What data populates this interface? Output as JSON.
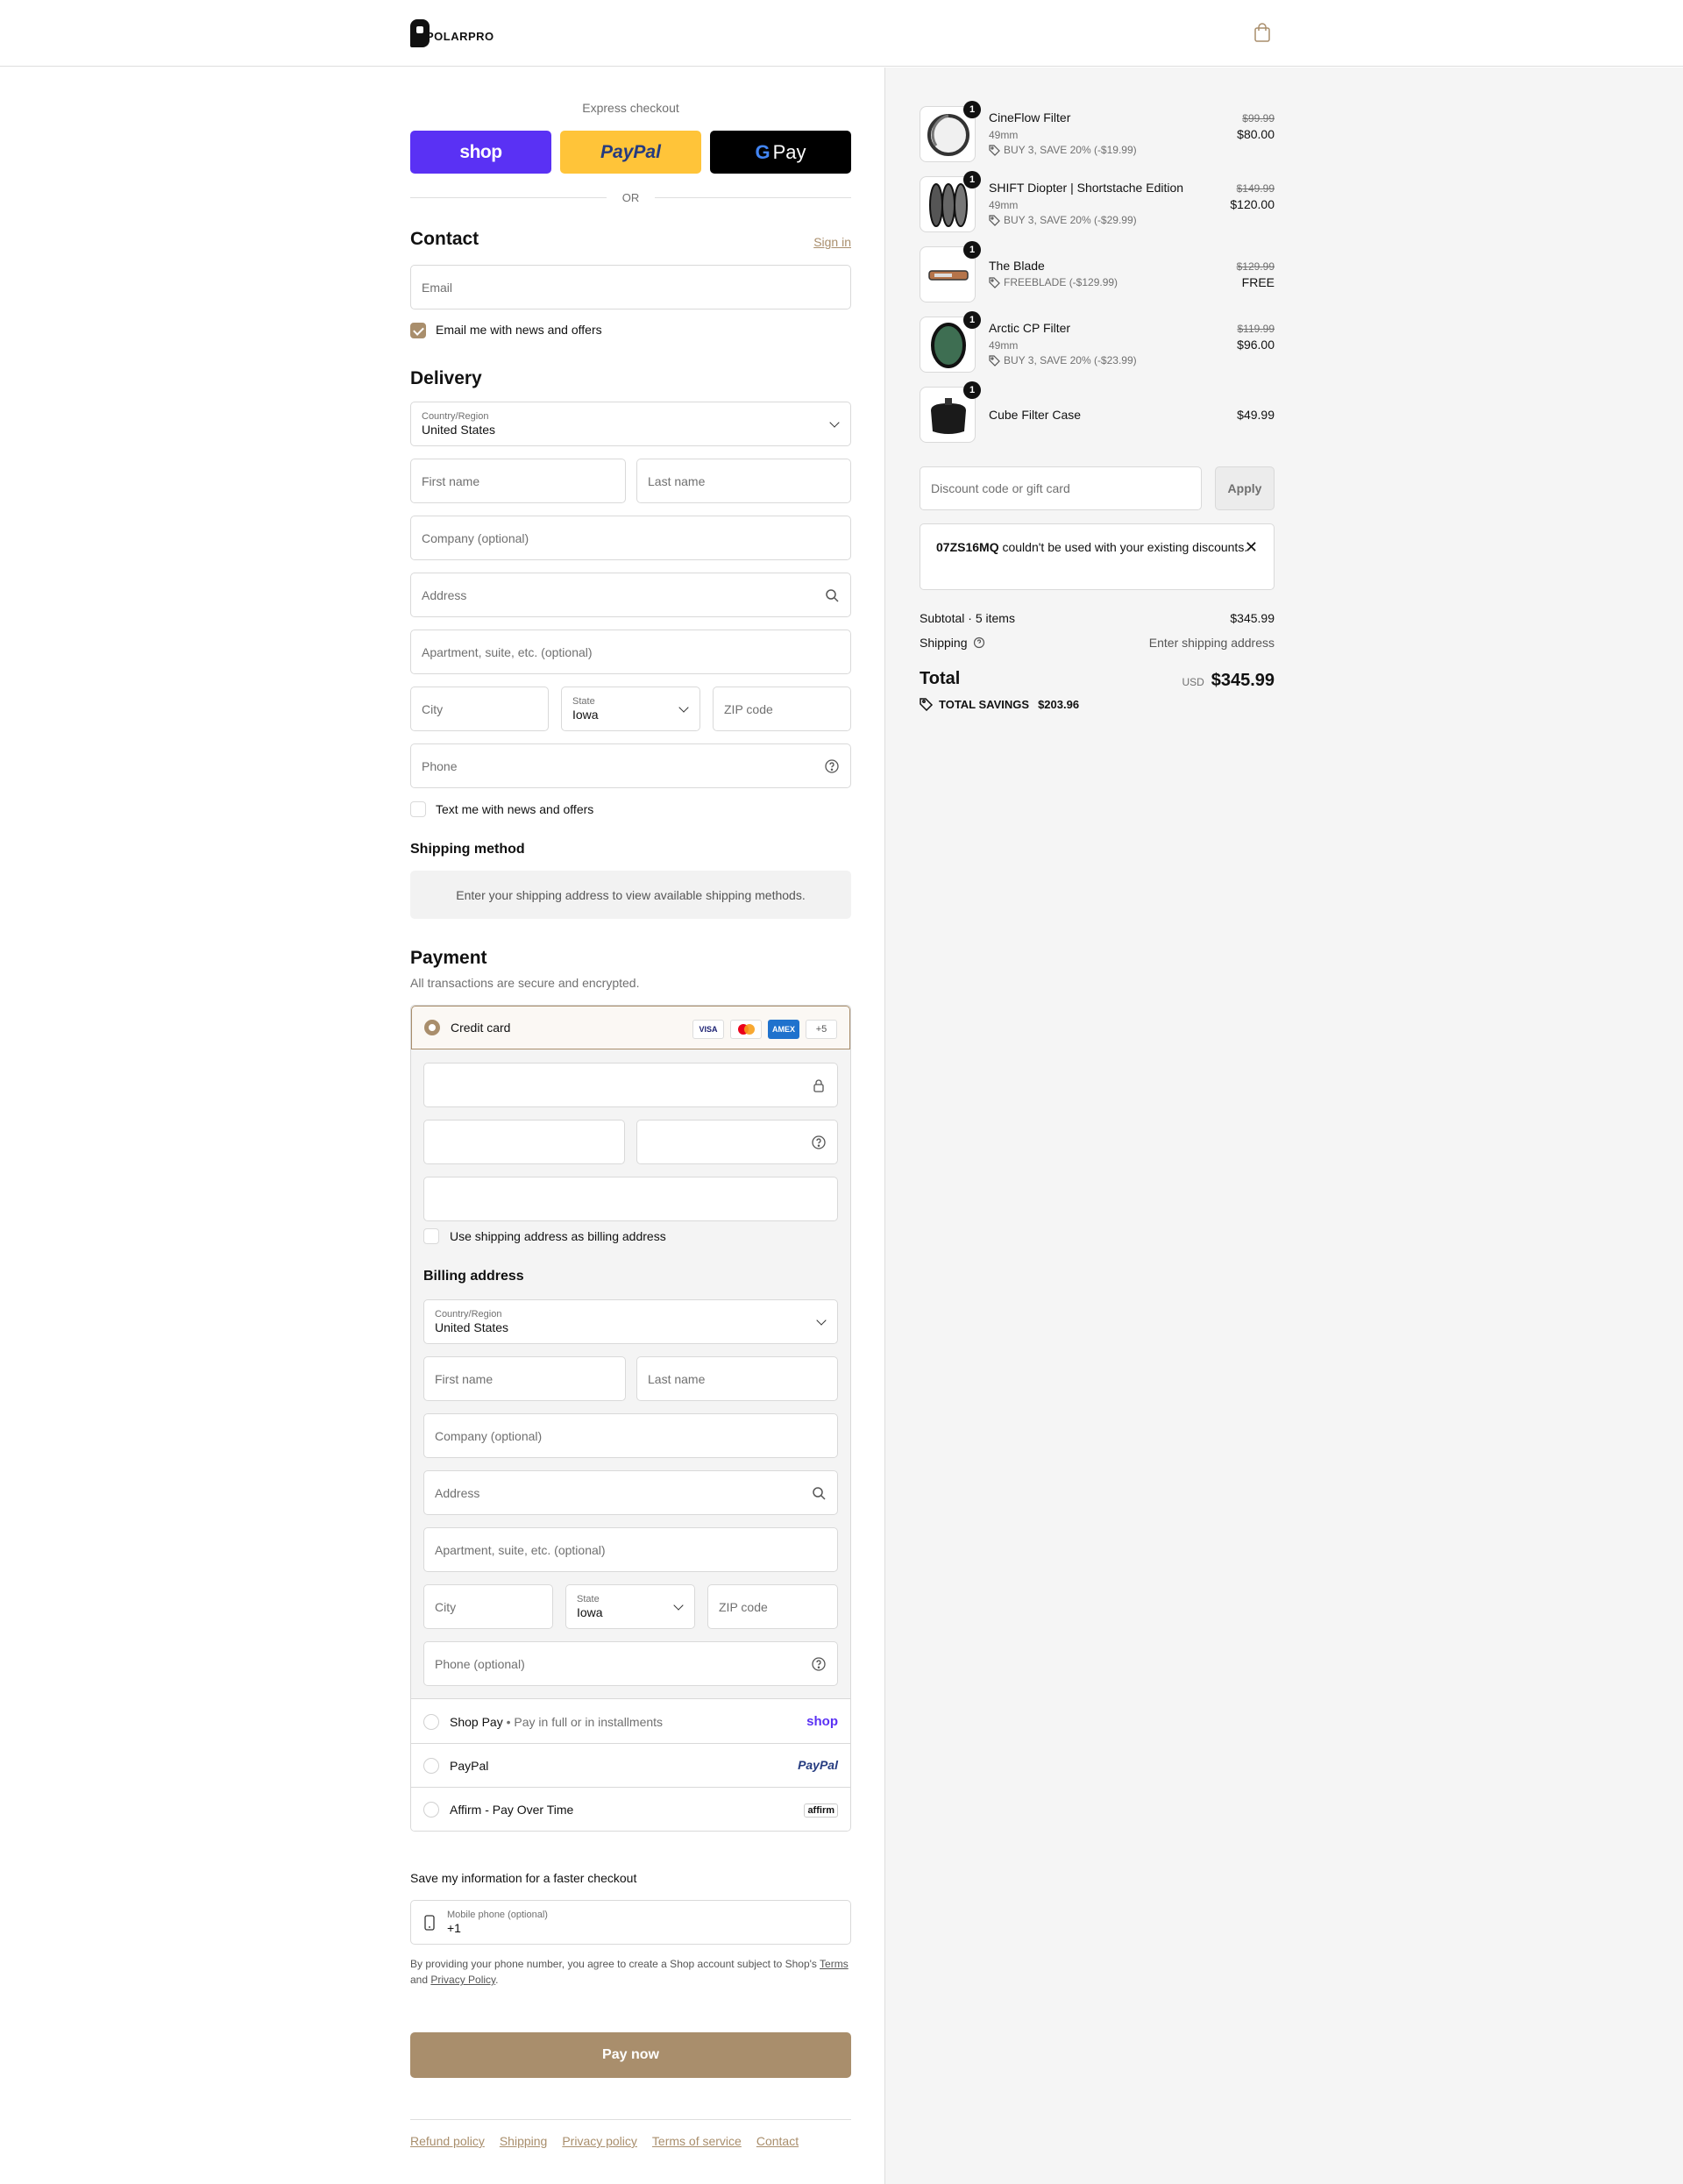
{
  "brand": {
    "name": "POLARPRO",
    "accent": "#a98e6c"
  },
  "header": {
    "cart_icon": "shopping-bag-icon"
  },
  "express": {
    "label": "Express checkout",
    "shop_label": "shop",
    "paypal_label": "PayPal",
    "gpay_label": "Pay",
    "or_label": "OR"
  },
  "contact": {
    "title": "Contact",
    "sign_in": "Sign in",
    "email_placeholder": "Email",
    "news_label": "Email me with news and offers"
  },
  "delivery": {
    "title": "Delivery",
    "country_label": "Country/Region",
    "country_value": "United States",
    "first_name": "First name",
    "last_name": "Last name",
    "company": "Company (optional)",
    "address": "Address",
    "apartment": "Apartment, suite, etc. (optional)",
    "city": "City",
    "state_label": "State",
    "state_value": "Iowa",
    "zip": "ZIP code",
    "phone": "Phone",
    "text_label": "Text me with news and offers"
  },
  "shipping": {
    "title": "Shipping method",
    "message": "Enter your shipping address to view available shipping methods."
  },
  "payment": {
    "title": "Payment",
    "subtitle": "All transactions are secure and encrypted.",
    "credit_card": "Credit card",
    "card_visa": "VISA",
    "card_amex": "AMEX",
    "card_more": "+5",
    "use_shipping": "Use shipping address as billing address",
    "billing_title": "Billing address",
    "billing": {
      "country_label": "Country/Region",
      "country_value": "United States",
      "first_name": "First name",
      "last_name": "Last name",
      "company": "Company (optional)",
      "address": "Address",
      "apartment": "Apartment, suite, etc. (optional)",
      "city": "City",
      "state_label": "State",
      "state_value": "Iowa",
      "zip": "ZIP code",
      "phone": "Phone (optional)"
    },
    "methods": [
      {
        "name": "Shop Pay",
        "sub": "Pay in full or in installments",
        "brand": "shop"
      },
      {
        "name": "PayPal",
        "sub": "",
        "brand": "PayPal"
      },
      {
        "name": "Affirm - Pay Over Time",
        "sub": "",
        "brand": "affirm"
      }
    ]
  },
  "save_info": {
    "title": "Save my information for a faster checkout",
    "phone_label": "Mobile phone (optional)",
    "phone_value": "+1",
    "terms_prefix": "By providing your phone number, you agree to create a Shop account subject to Shop's",
    "terms_link": "Terms",
    "terms_and": "and",
    "privacy_link": "Privacy Policy",
    "terms_suffix": "."
  },
  "pay_now": "Pay now",
  "footer_links": [
    "Refund policy",
    "Shipping",
    "Privacy policy",
    "Terms of service",
    "Contact"
  ],
  "cart": {
    "items": [
      {
        "qty": "1",
        "name": "CineFlow Filter",
        "variant": "49mm",
        "discount": "BUY 3, SAVE 20% (-$19.99)",
        "old_price": "$99.99",
        "price": "$80.00"
      },
      {
        "qty": "1",
        "name": "SHIFT Diopter | Shortstache Edition",
        "variant": "49mm",
        "discount": "BUY 3, SAVE 20% (-$29.99)",
        "old_price": "$149.99",
        "price": "$120.00"
      },
      {
        "qty": "1",
        "name": "The Blade",
        "variant": "",
        "discount": "FREEBLADE (-$129.99)",
        "old_price": "$129.99",
        "price": "FREE"
      },
      {
        "qty": "1",
        "name": "Arctic CP Filter",
        "variant": "49mm",
        "discount": "BUY 3, SAVE 20% (-$23.99)",
        "old_price": "$119.99",
        "price": "$96.00"
      },
      {
        "qty": "1",
        "name": "Cube Filter Case",
        "variant": "",
        "discount": "",
        "old_price": "",
        "price": "$49.99"
      }
    ],
    "discount_placeholder": "Discount code or gift card",
    "apply_label": "Apply",
    "error_code": "07ZS16MQ",
    "error_text": " couldn't be used with your existing discounts.",
    "subtotal_label": "Subtotal · 5 items",
    "subtotal_value": "$345.99",
    "shipping_label": "Shipping",
    "shipping_value": "Enter shipping address",
    "total_label": "Total",
    "currency": "USD",
    "total_value": "$345.99",
    "savings_label": "TOTAL SAVINGS",
    "savings_value": "$203.96"
  }
}
